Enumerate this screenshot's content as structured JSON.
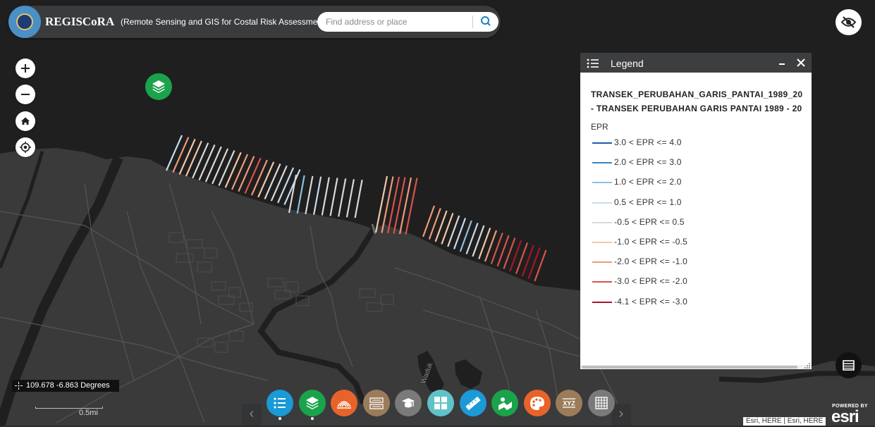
{
  "header": {
    "title": "REGISCoRA",
    "subtitle": "(Remote Sensing and GIS for Costal Risk Assessment)",
    "search_placeholder": "Find address or place"
  },
  "map": {
    "zoom_in_label": "+",
    "zoom_out_label": "−",
    "place_label": "Waduk",
    "coordinates": "109.678 -6.863 Degrees",
    "scale_label": "0.5mi",
    "attribution": "Esri, HERE | Esri, HERE",
    "powered_by": "POWERED BY",
    "esri_logo": "esri",
    "colors": {
      "land": "#3a3a3b",
      "water": "#1f1f20",
      "roads": "#5c5c5e"
    }
  },
  "legend": {
    "title": "Legend",
    "layer_line1": "TRANSEK_PERUBAHAN_GARIS_PANTAI_1989_20",
    "layer_line2": "- TRANSEK PERUBAHAN GARIS PANTAI 1989 - 20",
    "field": "EPR",
    "items": [
      {
        "label": "3.0 < EPR <= 4.0",
        "color": "#1f5aa8"
      },
      {
        "label": "2.0 < EPR <= 3.0",
        "color": "#3a82c4"
      },
      {
        "label": "1.0 < EPR <= 2.0",
        "color": "#8fbfdf"
      },
      {
        "label": "0.5 < EPR <= 1.0",
        "color": "#c7dcee"
      },
      {
        "label": "-0.5 < EPR <= 0.5",
        "color": "#d9d9d9"
      },
      {
        "label": "-1.0 < EPR <= -0.5",
        "color": "#f4c7a7"
      },
      {
        "label": "-2.0 < EPR <= -1.0",
        "color": "#ef9a78"
      },
      {
        "label": "-3.0 < EPR <= -2.0",
        "color": "#d9534a"
      },
      {
        "label": "-4.1 < EPR <= -3.0",
        "color": "#a51729"
      }
    ]
  },
  "toolbar": {
    "prev_label": "‹",
    "next_label": "›",
    "tools": [
      {
        "name": "legend-list-icon",
        "color": "#1a9ad6"
      },
      {
        "name": "layer-list-icon",
        "color": "#1aa34a"
      },
      {
        "name": "coastline-icon",
        "color": "#e8632a"
      },
      {
        "name": "text-tool-icon",
        "color": "#9b7c5a"
      },
      {
        "name": "basemap-icon",
        "color": "#7a7a7a"
      },
      {
        "name": "grid-icon",
        "color": "#5fc3c8"
      },
      {
        "name": "measure-icon",
        "color": "#1a9ad6"
      },
      {
        "name": "route-icon",
        "color": "#1aa34a"
      },
      {
        "name": "palette-icon",
        "color": "#e8632a"
      },
      {
        "name": "xyz-icon",
        "color": "#9b7c5a"
      },
      {
        "name": "table-grid-icon",
        "color": "#7a7a7a"
      }
    ],
    "xyz_text": "XYZ"
  }
}
